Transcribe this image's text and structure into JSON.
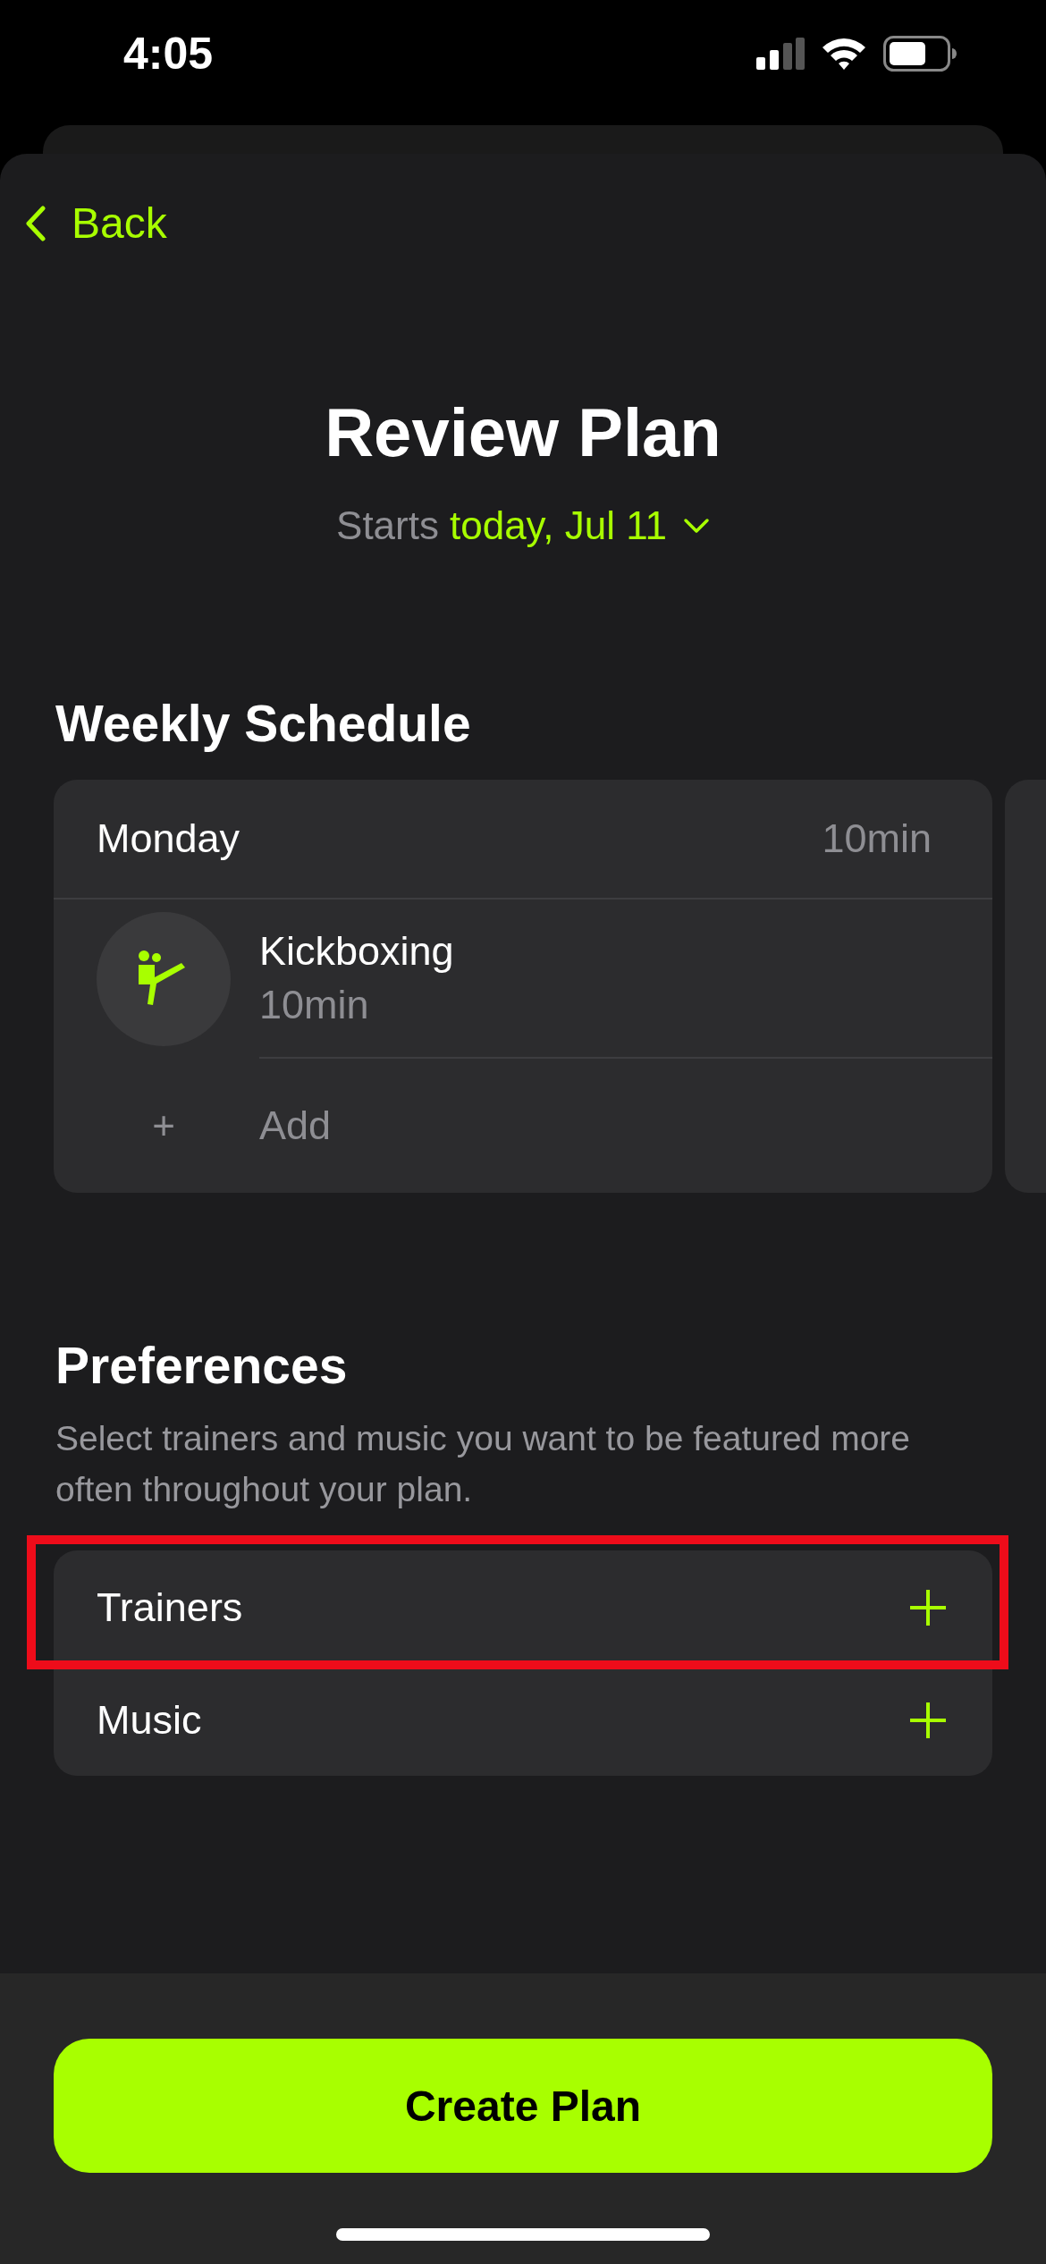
{
  "status_bar": {
    "time": "4:05"
  },
  "nav": {
    "back": "Back"
  },
  "header": {
    "title": "Review Plan",
    "starts_label": "Starts",
    "start_date": "today, Jul 11"
  },
  "schedule": {
    "title": "Weekly Schedule",
    "days": [
      {
        "day": "Monday",
        "total": "10min",
        "workouts": [
          {
            "name": "Kickboxing",
            "duration": "10min"
          }
        ],
        "add": "Add",
        "add_icon": "+"
      }
    ]
  },
  "preferences": {
    "title": "Preferences",
    "description": "Select trainers and music you want to be featured more often throughout your plan.",
    "items": [
      {
        "label": "Trainers",
        "highlighted": true
      },
      {
        "label": "Music",
        "highlighted": false
      }
    ]
  },
  "primary_button": "Create Plan"
}
